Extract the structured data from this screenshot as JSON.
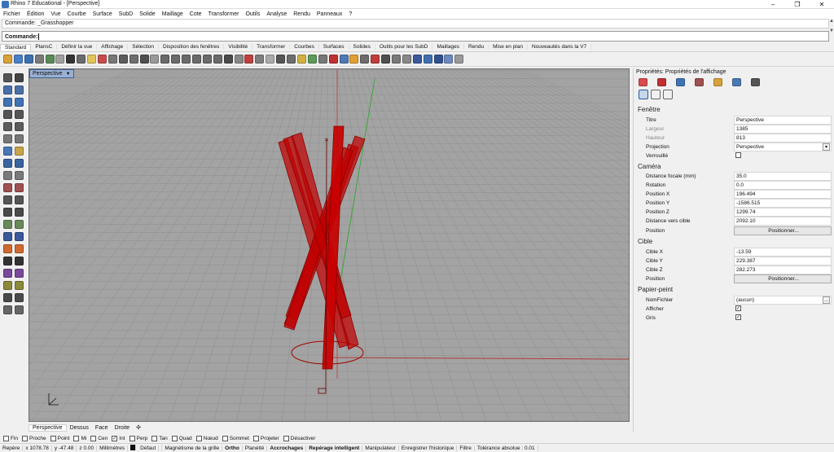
{
  "window": {
    "title": "Rhino 7 Educational - [Perspective]"
  },
  "menu": [
    "Fichier",
    "Édition",
    "Vue",
    "Courbe",
    "Surface",
    "SubD",
    "Solide",
    "Maillage",
    "Cote",
    "Transformer",
    "Outils",
    "Analyse",
    "Rendu",
    "Panneaux",
    "?"
  ],
  "command": {
    "history": "Commande: _Grasshopper",
    "prompt": "Commande:"
  },
  "toolbar_tabs": [
    "Standard",
    "PlansC",
    "Définir la vue",
    "Affichage",
    "Sélection",
    "Disposition des fenêtres",
    "Visibilité",
    "Transformer",
    "Courbes",
    "Surfaces",
    "Solides",
    "Outils pour les SubD",
    "Maillages",
    "Rendu",
    "Mise en plan",
    "Nouveautés dans la V7"
  ],
  "viewport": {
    "label": "Perspective",
    "dropdown_glyph": "▼"
  },
  "view_tabs": [
    "Perspective",
    "Dessus",
    "Face",
    "Droite",
    "✣"
  ],
  "osnaps": [
    {
      "label": "Fin",
      "checked": false
    },
    {
      "label": "Proche",
      "checked": false
    },
    {
      "label": "Point",
      "checked": false
    },
    {
      "label": "Mi",
      "checked": false
    },
    {
      "label": "Cen",
      "checked": false
    },
    {
      "label": "Int",
      "checked": true
    },
    {
      "label": "Perp",
      "checked": false
    },
    {
      "label": "Tan",
      "checked": false
    },
    {
      "label": "Quad",
      "checked": false
    },
    {
      "label": "Nœud",
      "checked": false
    },
    {
      "label": "Sommet",
      "checked": false
    },
    {
      "label": "Projeter",
      "checked": false
    },
    {
      "label": "Désactiver",
      "checked": false
    }
  ],
  "status": {
    "cplane": "Repère",
    "x": "x 1078.78",
    "y": "y -47.48",
    "z": "z 0.00",
    "units": "Millimètres",
    "layer": "Défaut",
    "toggles": [
      "Magnétisme de la grille",
      "Ortho",
      "Planéité",
      "Accrochages",
      "Repérage intelligent",
      "Manipulateur",
      "Enregistrer l'historique",
      "Filtre"
    ],
    "tolerance": "Tolérance absolue : 0.01"
  },
  "panel": {
    "title": "Propriétés: Propriétés de l'affichage",
    "sections": {
      "fenetre": "Fenêtre",
      "camera": "Caméra",
      "cible": "Cible",
      "papier": "Papier-peint"
    },
    "fields": {
      "titre": {
        "label": "Titre",
        "value": "Perspective"
      },
      "largeur": {
        "label": "Largeur",
        "value": "1385"
      },
      "hauteur": {
        "label": "Hauteur",
        "value": "813"
      },
      "projection": {
        "label": "Projection",
        "value": "Perspective"
      },
      "verrouille": {
        "label": "Verrouillé",
        "checked": false
      },
      "focale": {
        "label": "Distance focale (mm)",
        "value": "35.0"
      },
      "rotation": {
        "label": "Rotation",
        "value": "0.0"
      },
      "posx": {
        "label": "Position X",
        "value": "196.494"
      },
      "posy": {
        "label": "Position Y",
        "value": "-1586.515"
      },
      "posz": {
        "label": "Position Z",
        "value": "1299.74"
      },
      "distcible": {
        "label": "Distance vers cible",
        "value": "2092.10"
      },
      "position": {
        "label": "Position",
        "button": "Positionner..."
      },
      "ciblex": {
        "label": "Cible X",
        "value": "-13.59"
      },
      "cibley": {
        "label": "Cible Y",
        "value": "229.387"
      },
      "ciblez": {
        "label": "Cible Z",
        "value": "282.273"
      },
      "cposition": {
        "label": "Position",
        "button": "Positionner..."
      },
      "nomfichier": {
        "label": "NomFichier",
        "value": "(aucun)",
        "button": "..."
      },
      "afficher": {
        "label": "Afficher",
        "checked": true
      },
      "gris": {
        "label": "Gris",
        "checked": true
      }
    }
  },
  "colors": {
    "accent": "#3d5d93",
    "viewport_bg": "#a3a3a3",
    "grid": "#8c8c8c",
    "object_red": "#c00000",
    "x_axis": "#b33a3a",
    "y_axis": "#3aa63a"
  }
}
